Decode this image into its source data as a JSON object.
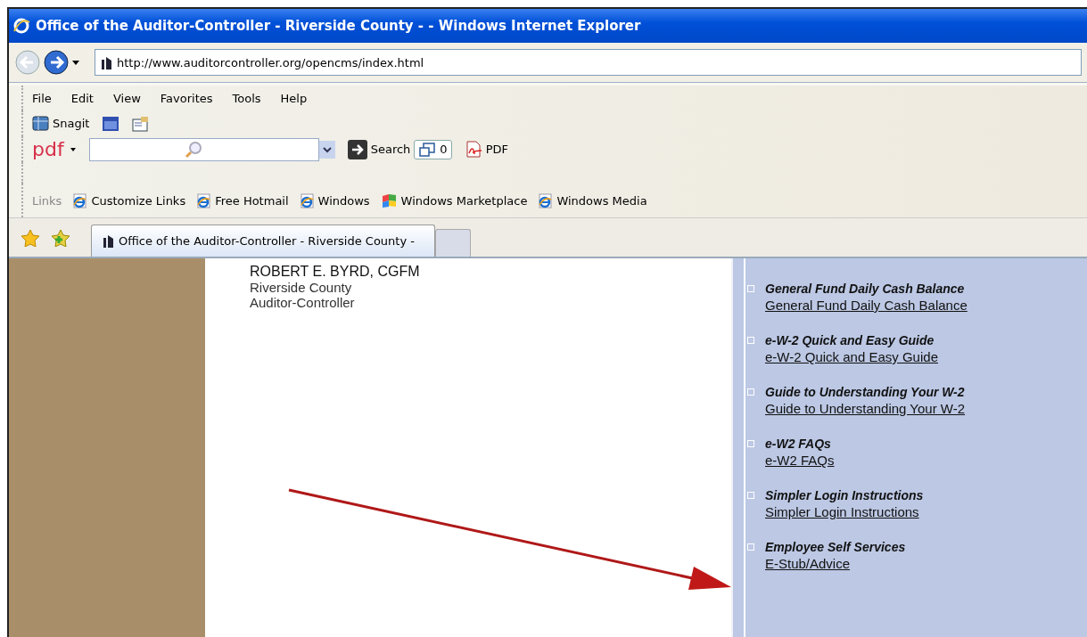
{
  "window": {
    "title": "Office of the Auditor-Controller - Riverside County - - Windows Internet Explorer"
  },
  "address": {
    "url": "http://www.auditorcontroller.org/opencms/index.html"
  },
  "menu": [
    "File",
    "Edit",
    "View",
    "Favorites",
    "Tools",
    "Help"
  ],
  "snagit": {
    "label": "Snagit"
  },
  "pdf_bar": {
    "logo": "pdf",
    "search_label": "Search",
    "count": "0",
    "pdf_label": "PDF"
  },
  "links_bar": {
    "label": "Links",
    "links": [
      "Customize Links",
      "Free Hotmail",
      "Windows",
      "Windows Marketplace",
      "Windows Media"
    ]
  },
  "tabs": [
    {
      "label": "Office of the Auditor-Controller - Riverside County -",
      "selected": true
    }
  ],
  "content": {
    "name": "ROBERT E. BYRD, CGFM",
    "lines": [
      "Riverside County",
      "Auditor-Controller"
    ]
  },
  "sidebar": {
    "sections": [
      {
        "heading": "General Fund Daily Cash Balance",
        "link": "General Fund Daily Cash Balance"
      },
      {
        "heading": "e-W-2 Quick and Easy Guide",
        "link": "e-W-2 Quick and Easy Guide"
      },
      {
        "heading": "Guide to Understanding Your W-2",
        "link": "Guide to Understanding Your W-2"
      },
      {
        "heading": "e-W2 FAQs",
        "link": "e-W2 FAQs"
      },
      {
        "heading": "Simpler Login Instructions",
        "link": "Simpler Login Instructions"
      },
      {
        "heading": "Employee Self Services",
        "link": "E-Stub/Advice"
      }
    ]
  }
}
